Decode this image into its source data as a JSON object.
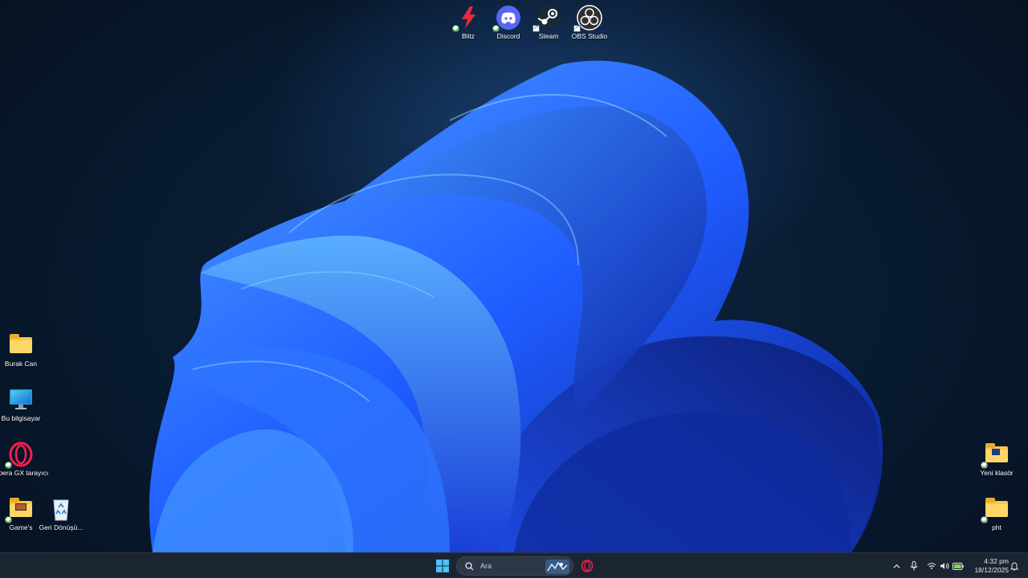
{
  "desktop": {
    "top_icons": [
      {
        "label": "Blitz",
        "icon": "blitz-icon"
      },
      {
        "label": "Discord",
        "icon": "discord-icon"
      },
      {
        "label": "Steam",
        "icon": "steam-icon"
      },
      {
        "label": "OBS Studio",
        "icon": "obs-icon"
      }
    ],
    "left_icons": [
      {
        "label": "Burak Can",
        "icon": "folder-icon"
      },
      {
        "label": "Bu bilgisayar",
        "icon": "computer-icon"
      },
      {
        "label": "Opera GX tarayıcı",
        "icon": "opera-gx-icon"
      },
      {
        "label": "Game's",
        "icon": "folder-icon"
      },
      {
        "label": "Geri Dönüşü...",
        "icon": "recycle-bin-icon"
      }
    ],
    "right_icons": [
      {
        "label": "Yeni klasör",
        "icon": "folder-icon"
      },
      {
        "label": "pht",
        "icon": "folder-icon"
      }
    ]
  },
  "taskbar": {
    "search_placeholder": "Ara",
    "clock_time": "4:32 pm",
    "clock_date": "18/12/2025"
  },
  "colors": {
    "accent": "#2f6bff",
    "taskbar": "#1b2431",
    "folder": "#f8c64a"
  }
}
